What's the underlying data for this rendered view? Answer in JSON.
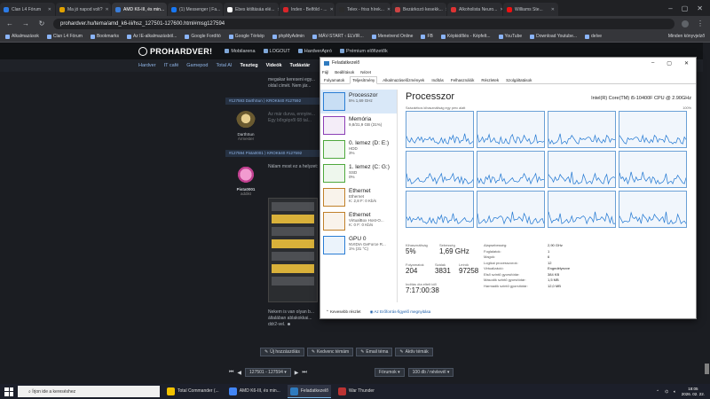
{
  "browser": {
    "tabs": [
      {
        "label": "Clan L4 Fórum",
        "color": "#2c7be5"
      },
      {
        "label": "Ma jó napod volt?",
        "color": "#e0a100"
      },
      {
        "label": "AMD K6-III, és min...",
        "color": "#3b7dd8",
        "active": true
      },
      {
        "label": "(1) Messenger | Fa...",
        "color": "#1877f2"
      },
      {
        "label": "Ebes kitiltásáa elé...",
        "color": "#ffffff"
      },
      {
        "label": "Index - Belföld - ...",
        "color": "#d9252a"
      },
      {
        "label": "Telex - friss hírek...",
        "color": "#2b2b2b"
      },
      {
        "label": "Bezárkozó kesekk...",
        "color": "#c44"
      },
      {
        "label": "Alkoholista Neuro...",
        "color": "#d33"
      },
      {
        "label": "Williams Ste...",
        "color": "#e11"
      }
    ],
    "url": "prohardver.hu/tema/amd_k6-iii/hsz_127501-127600.html#msg127594",
    "bookmarks": [
      "Alkalmazások",
      "Clan L4 Fórum",
      "Bookmarks",
      "Az IE-alkalmazásból...",
      "Google Fordító",
      "Google Térkép",
      "phpMyAdmin",
      "MÁV-START ‹ ELVIR...",
      "Menetrend Online",
      "FB",
      "Képkidőlés - Képfelt...",
      "YouTube",
      "Download Youtube...",
      "delve"
    ],
    "other_bookmarks": "Minden könyvjelző"
  },
  "site": {
    "logo": "PROHARDVER!",
    "top_links": [
      "Mobilarena",
      "LOGOUT",
      "HardverApró",
      "Prémium előfizetők"
    ],
    "nav": [
      "Hardver",
      "IT café",
      "Gamepod",
      "Total AI",
      "Teszteg",
      "Videók",
      "Tudástár"
    ],
    "posts": [
      {
        "head": "#127593 DarthSun ⟩ KROK640 #127592",
        "author": "DarthSun",
        "role": "Ármester",
        "text": [
          "Az már durva, ennyire...",
          "Egy bőrgépről 68 tal..."
        ]
      },
      {
        "head": "#127594 Pista0001 ⟩ KROK640 #127592",
        "author": "Pista0001",
        "role": "addikt",
        "text": [
          "Nálam most ez a helyzet:"
        ]
      }
    ],
    "intro_text": [
      "megakar kereseni egy...",
      "oldal címét. Nem jár..."
    ],
    "post_bottom_text": [
      "Nekem is van olyan b...",
      "általában ablakokkai...",
      "ddr2-vel. ☻"
    ],
    "buttons": [
      "Új hozzászólás",
      "Kedvenc témám",
      "Email téma",
      "Aktív témák"
    ],
    "pager": "127501 - 127594",
    "forum_select": "Fórumok",
    "page_size": "100 db / névlevél"
  },
  "task_manager": {
    "title": "Feladatkezelő",
    "menu": [
      "Fájl",
      "Beállítások",
      "Nézet"
    ],
    "tabs": [
      "Folyamatok",
      "Teljesítmény",
      "Alkalmazáselőzmények",
      "Indítás",
      "Felhasználók",
      "Részletek",
      "Szolgáltatások"
    ],
    "resources": [
      {
        "name": "Processzor",
        "sub": "5% 1,69 GHz",
        "color": "#2a7dd4",
        "selected": true
      },
      {
        "name": "Memória",
        "sub": "9,8/31,9 GB (31%)",
        "color": "#8b3fb5"
      },
      {
        "name": "0. lemez (D: E:)",
        "sub": "HDD\n3%",
        "color": "#4fa83d"
      },
      {
        "name": "1. lemez (C: G:)",
        "sub": "SSD\n0%",
        "color": "#4fa83d"
      },
      {
        "name": "Ethernet",
        "sub": "Ethernet\nK: 2,8 F: 0 Kb/s",
        "color": "#c0802a"
      },
      {
        "name": "Ethernet",
        "sub": "VirtualBox Host-O...\nK: 0 F: 0 Kb/s",
        "color": "#c0802a"
      },
      {
        "name": "GPU 0",
        "sub": "NVIDIA GeForce R...\n1% (31 °C)",
        "color": "#2a7dd4"
      }
    ],
    "heading": "Processzor",
    "cpu_model": "Intel(R) Core(TM) i5-10400F CPU @ 2.90GHz",
    "graph_label": "Százalékos kihasználtság egy perc alatt",
    "graph_max": "100%",
    "usage_label": "Kihasználtság",
    "usage_value": "5%",
    "speed_label": "Sebesség",
    "speed_value": "1,69 GHz",
    "proc_label": "Folyamatok",
    "proc_value": "204",
    "thread_label": "Szálak",
    "thread_value": "3831",
    "handle_label": "Leírók",
    "handle_value": "97258",
    "uptime_label": "Indítás óta eltelt idő",
    "uptime_value": "7:17:00:38",
    "details": [
      {
        "k": "Alapsebesség:",
        "v": "2,90 GHz"
      },
      {
        "k": "Foglalatok:",
        "v": "1"
      },
      {
        "k": "Magok:",
        "v": "6"
      },
      {
        "k": "Logikai processzorok:",
        "v": "12"
      },
      {
        "k": "Virtualizáció:",
        "v": "Engedélyezve"
      },
      {
        "k": "Első szintű gyorsítótár:",
        "v": "384 KB"
      },
      {
        "k": "Második szintű gyorsítótár:",
        "v": "1,5 MB"
      },
      {
        "k": "Harmadik szintű gyorsítótár:",
        "v": "12,0 MB"
      }
    ],
    "fewer_details": "Kevesebb részlet",
    "open_monitor": "Az Erőforrás-figyelő megnyitása"
  },
  "taskbar": {
    "search_placeholder": "Írjon ide a kereséshez",
    "items": [
      {
        "label": "Total Commander (...",
        "color": "#f2c200"
      },
      {
        "label": "AMD K6-III, és min...",
        "color": "#4285f4"
      },
      {
        "label": "Feladatkezelő",
        "color": "#2f7bbf",
        "active": true
      },
      {
        "label": "War Thunder",
        "color": "#b33"
      }
    ],
    "time": "18:05",
    "date": "2026. 02. 22."
  }
}
